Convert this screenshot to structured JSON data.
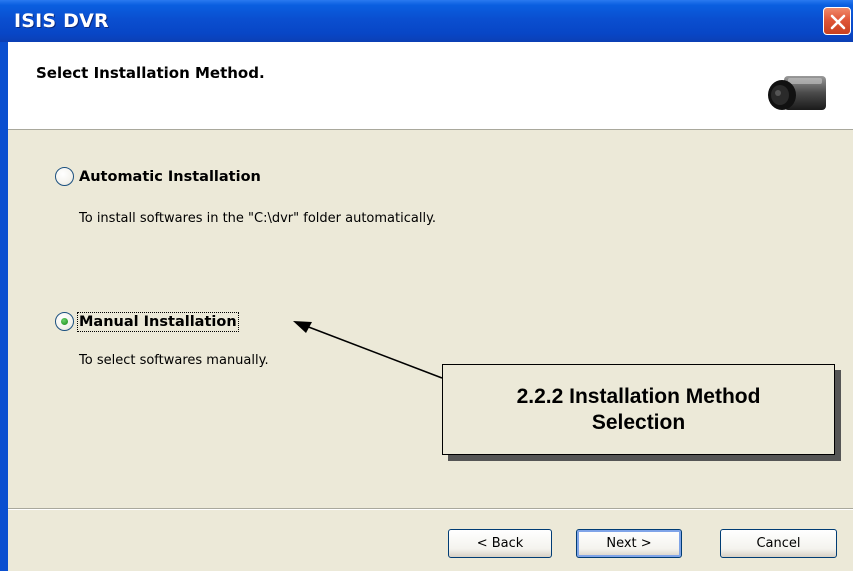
{
  "window": {
    "title": "ISIS DVR"
  },
  "header": {
    "title": "Select Installation Method."
  },
  "options": [
    {
      "label": "Automatic Installation",
      "description": "To install softwares in the \"C:\\dvr\" folder automatically.",
      "checked": false
    },
    {
      "label": "Manual Installation",
      "description": "To select softwares manually.",
      "checked": true
    }
  ],
  "callout": {
    "line1": "2.2.2 Installation Method",
    "line2": "Selection"
  },
  "buttons": {
    "back": "< Back",
    "next": "Next >",
    "cancel": "Cancel"
  },
  "icons": {
    "close": "close-icon",
    "camera": "camera-icon",
    "arrow": "annotation-arrow-icon"
  },
  "colors": {
    "titlebar": "#0A4FD0",
    "dialog_bg": "#ECE9D8",
    "close_button": "#E0573A",
    "radio_checked": "#2E9E2E"
  }
}
